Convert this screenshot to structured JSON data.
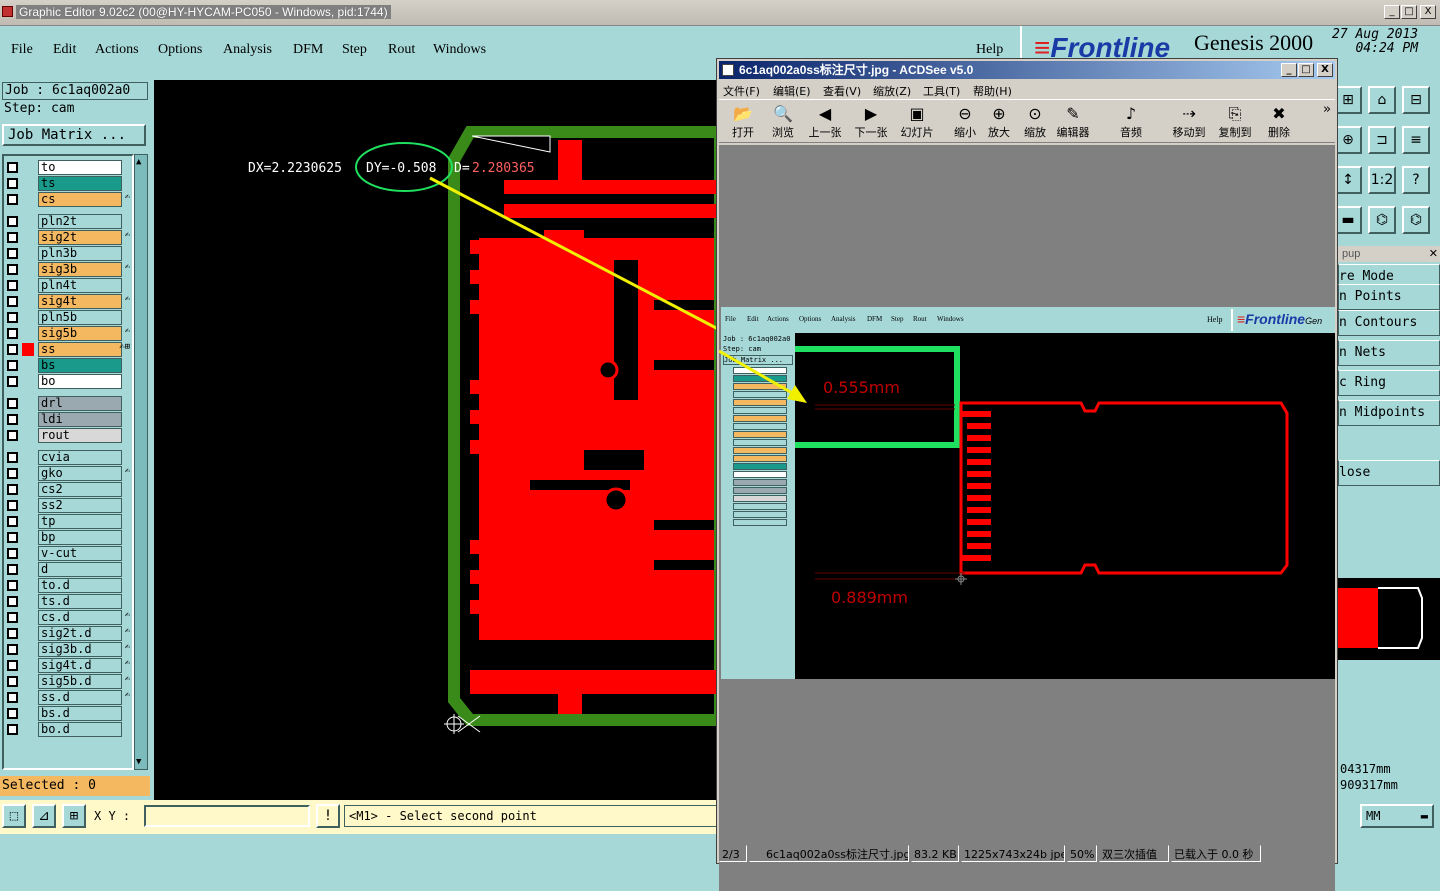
{
  "window": {
    "title": "Graphic Editor 9.02c2 (00@HY-HYCAM-PC050 - Windows, pid:1744)",
    "btn_min": "_",
    "btn_max": "□",
    "btn_close": "X"
  },
  "menu": {
    "file": "File",
    "edit": "Edit",
    "actions": "Actions",
    "options": "Options",
    "analysis": "Analysis",
    "dfm": "DFM",
    "step": "Step",
    "rout": "Rout",
    "windows": "Windows",
    "help": "Help"
  },
  "brand": {
    "logo": "Frontline",
    "product": "Genesis 2000",
    "date": "27 Aug 2013",
    "time": "04:24 PM"
  },
  "job": {
    "job_line": "Job : 6c1aq002a0",
    "step_line": "Step: cam",
    "matrix_button": "Job Matrix ..."
  },
  "layers": [
    {
      "name": "to",
      "color": "#ffffff"
    },
    {
      "name": "ts",
      "color": "#1a9a8a"
    },
    {
      "name": "cs",
      "color": "#f4b860",
      "flag": "✍"
    },
    {
      "name": "pln2t",
      "color": "#a6d8d8"
    },
    {
      "name": "sig2t",
      "color": "#f4b860",
      "flag": "✍"
    },
    {
      "name": "pln3b",
      "color": "#a6d8d8"
    },
    {
      "name": "sig3b",
      "color": "#f4b860",
      "flag": "✍"
    },
    {
      "name": "pln4t",
      "color": "#a6d8d8"
    },
    {
      "name": "sig4t",
      "color": "#f4b860",
      "flag": "✍"
    },
    {
      "name": "pln5b",
      "color": "#a6d8d8"
    },
    {
      "name": "sig5b",
      "color": "#f4b860",
      "flag": "✍"
    },
    {
      "name": "ss",
      "color": "#f4b860",
      "flag": "✍⊞"
    },
    {
      "name": "bs",
      "color": "#1a9a8a"
    },
    {
      "name": "bo",
      "color": "#ffffff"
    },
    {
      "name": "drl",
      "color": "#9aa8b0"
    },
    {
      "name": "ldi",
      "color": "#9aa8b0"
    },
    {
      "name": "rout",
      "color": "#d8d8d8"
    },
    {
      "name": "cvia",
      "color": "#a6d8d8"
    },
    {
      "name": "gko",
      "color": "#a6d8d8",
      "flag": "✍"
    },
    {
      "name": "cs2",
      "color": "#a6d8d8"
    },
    {
      "name": "ss2",
      "color": "#a6d8d8"
    },
    {
      "name": "tp",
      "color": "#a6d8d8"
    },
    {
      "name": "bp",
      "color": "#a6d8d8"
    },
    {
      "name": "v-cut",
      "color": "#a6d8d8"
    },
    {
      "name": "d",
      "color": "#a6d8d8"
    },
    {
      "name": "to.d",
      "color": "#a6d8d8"
    },
    {
      "name": "ts.d",
      "color": "#a6d8d8"
    },
    {
      "name": "cs.d",
      "color": "#a6d8d8",
      "flag": "✍"
    },
    {
      "name": "sig2t.d",
      "color": "#a6d8d8",
      "flag": "✍"
    },
    {
      "name": "sig3b.d",
      "color": "#a6d8d8",
      "flag": "✍"
    },
    {
      "name": "sig4t.d",
      "color": "#a6d8d8",
      "flag": "✍"
    },
    {
      "name": "sig5b.d",
      "color": "#a6d8d8",
      "flag": "✍"
    },
    {
      "name": "ss.d",
      "color": "#a6d8d8",
      "flag": "✍"
    },
    {
      "name": "bs.d",
      "color": "#a6d8d8"
    },
    {
      "name": "bo.d",
      "color": "#a6d8d8"
    }
  ],
  "selected": "Selected : 0",
  "measure": {
    "dx": "DX=2.2230625",
    "dy": "DY=-0.508",
    "d_label": "D=",
    "d_value": "2.280365"
  },
  "bottom": {
    "xy_label": "X Y :",
    "xy_value": "",
    "warn": "!",
    "message": "<M1> - Select second point"
  },
  "right_popup": {
    "title": "pup",
    "items": [
      "re Mode",
      "n Points",
      "n Contours",
      "n Nets",
      "c Ring",
      "n Midpoints",
      "lose"
    ],
    "readout1": "04317mm",
    "readout2": "909317mm",
    "units": "MM"
  },
  "right_icons": [
    "⊞",
    "⌂",
    "⊟",
    "⊕",
    "⊐",
    "≡",
    "↕",
    "1:2",
    "?",
    "▬",
    "⌬",
    "⌬"
  ],
  "acdsee": {
    "title": "6c1aq002a0ss标注尺寸.jpg - ACDSee v5.0",
    "menu": [
      "文件(F)",
      "编辑(E)",
      "查看(V)",
      "缩放(Z)",
      "工具(T)",
      "帮助(H)"
    ],
    "tools": [
      {
        "label": "打开",
        "icon": "open-icon",
        "glyph": "📂"
      },
      {
        "label": "浏览",
        "icon": "browse-icon",
        "glyph": "🔍"
      },
      {
        "label": "上一张",
        "icon": "prev-icon",
        "glyph": "◀"
      },
      {
        "label": "下一张",
        "icon": "next-icon",
        "glyph": "▶"
      },
      {
        "label": "幻灯片",
        "icon": "slideshow-icon",
        "glyph": "▣"
      },
      {
        "label": "缩小",
        "icon": "zoom-out-icon",
        "glyph": "⊖"
      },
      {
        "label": "放大",
        "icon": "zoom-in-icon",
        "glyph": "⊕"
      },
      {
        "label": "缩放",
        "icon": "zoom-icon",
        "glyph": "⊙"
      },
      {
        "label": "编辑器",
        "icon": "editor-icon",
        "glyph": "✎"
      },
      {
        "label": "音频",
        "icon": "audio-icon",
        "glyph": "♪"
      },
      {
        "label": "移动到",
        "icon": "move-icon",
        "glyph": "⇢"
      },
      {
        "label": "复制到",
        "icon": "copy-icon",
        "glyph": "⎘"
      },
      {
        "label": "删除",
        "icon": "delete-icon",
        "glyph": "✖"
      }
    ],
    "more": "»",
    "status": {
      "index": "2/3",
      "file": "6c1aq002a0ss标注尺寸.jpg",
      "size": "83.2 KB",
      "dims": "1225x743x24b jpeg",
      "zoom": "50%",
      "interp": "双三次插值",
      "load": "已载入于 0.0 秒"
    },
    "inner": {
      "menu": [
        "File",
        "Edit",
        "Actions",
        "Options",
        "Analysis",
        "DFM",
        "Step",
        "Rout",
        "Windows"
      ],
      "help": "Help",
      "logo": "Frontline",
      "logo_tail": "Gen",
      "job": "Job : 6c1aq002a0",
      "step": "Step: cam",
      "matrix": "Job Matrix ...",
      "dim1": "0.555mm",
      "dim2": "0.889mm"
    }
  },
  "colors": {
    "bg": "#a6d8d8",
    "copper": "#ff0000",
    "outline": "#3a8a1a",
    "highlight": "#20e060",
    "arrow": "#f0f000"
  }
}
